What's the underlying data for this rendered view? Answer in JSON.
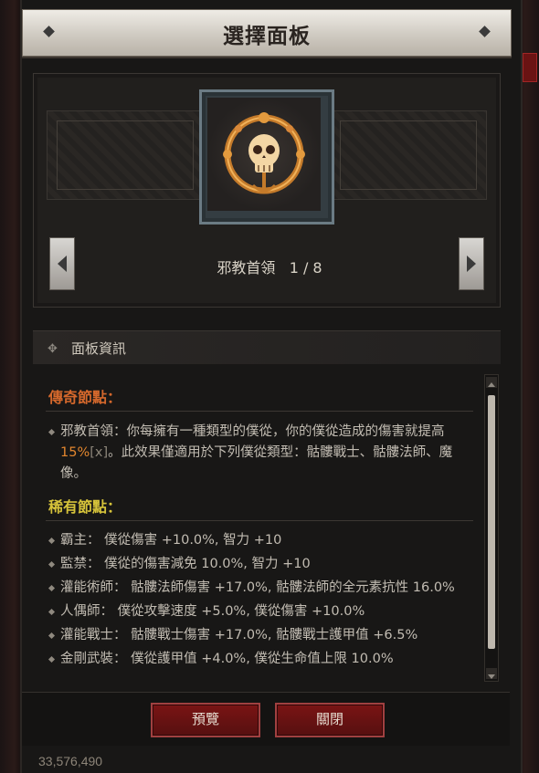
{
  "window": {
    "title": "選擇面板"
  },
  "glyph": {
    "name": "邪教首領",
    "counter": "1 / 8"
  },
  "info": {
    "header": "面板資訊",
    "legendary": {
      "title": "傳奇節點：",
      "text_before": "邪教首領：你每擁有一種類型的僕從，你的僕從造成的傷害就提高",
      "percent": "15%",
      "bracket": "[x]",
      "text_after": "。此效果僅適用於下列僕從類型：骷髏戰士、骷髏法師、魔像。"
    },
    "rare": {
      "title": "稀有節點：",
      "items": [
        "霸主： 僕從傷害 +10.0%, 智力 +10",
        "監禁： 僕從的傷害減免 10.0%, 智力 +10",
        "灌能術師： 骷髏法師傷害 +17.0%, 骷髏法師的全元素抗性 16.0%",
        "人偶師： 僕從攻擊速度 +5.0%, 僕從傷害 +10.0%",
        "灌能戰士： 骷髏戰士傷害 +17.0%, 骷髏戰士護甲值 +6.5%",
        "金剛武裝： 僕從護甲值 +4.0%, 僕從生命值上限 10.0%"
      ]
    }
  },
  "buttons": {
    "preview": "預覽",
    "close": "關閉"
  },
  "gold": "33,576,490",
  "colors": {
    "legendary": "#d4682c",
    "rare": "#d6c33a",
    "button": "#6a1212"
  }
}
